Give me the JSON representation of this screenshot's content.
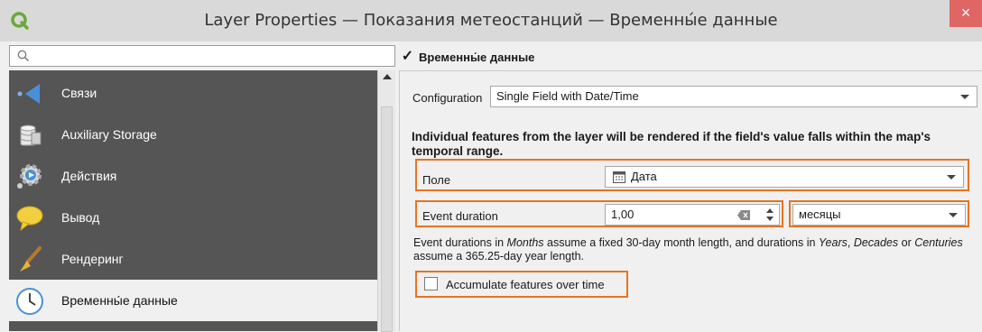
{
  "window": {
    "title": "Layer Properties — Показания метеостанций — Временны́е данные",
    "close_glyph": "×",
    "accent": "#e8731f"
  },
  "sidebar": {
    "search_value": "",
    "items": [
      {
        "label": "Связи",
        "icon": "relations-icon"
      },
      {
        "label": "Auxiliary Storage",
        "icon": "database-icon"
      },
      {
        "label": "Действия",
        "icon": "actions-gear-icon"
      },
      {
        "label": "Вывод",
        "icon": "display-speech-bubble-icon"
      },
      {
        "label": "Рендеринг",
        "icon": "rendering-brush-icon"
      },
      {
        "label": "Временны́е данные",
        "icon": "clock-icon"
      }
    ],
    "selected_index": 5
  },
  "temporal": {
    "enabled": true,
    "group_title": "Временны́е данные",
    "configuration_label": "Configuration",
    "configuration_value": "Single Field with Date/Time",
    "description": "Individual features from the layer will be rendered if the field's value falls within the map's temporal range.",
    "field_label": "Поле",
    "field_value": "Дата",
    "event_duration_label": "Event duration",
    "event_duration_value": "1,00",
    "duration_unit_value": "месяцы",
    "note_part1": "Event durations in ",
    "note_months": "Months",
    "note_part2": " assume a fixed 30-day month length, and durations in ",
    "note_years": "Years",
    "note_part3": ", ",
    "note_decades": "Decades",
    "note_part4": " or ",
    "note_centuries": "Centuries",
    "note_part5": " assume a 365.25-day year length.",
    "accumulate_label": "Accumulate features over time",
    "accumulate_checked": false
  }
}
